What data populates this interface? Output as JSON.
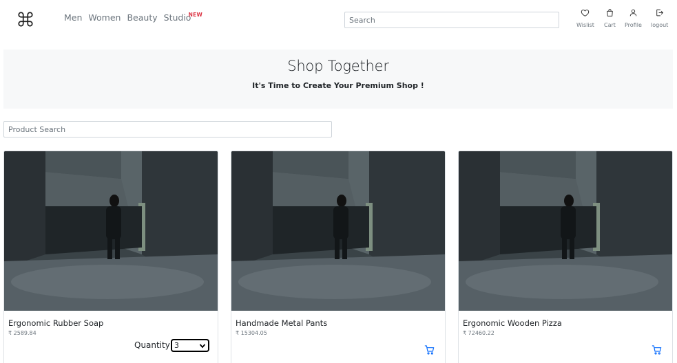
{
  "navbar": {
    "logo_icon": "command-key-icon",
    "links": [
      "Men",
      "Women",
      "Beauty",
      "Studio"
    ],
    "studio_badge": "NEW",
    "search_placeholder": "Search",
    "icons": [
      {
        "label": "Wislist",
        "icon": "heart-icon"
      },
      {
        "label": "Cart",
        "icon": "shopping-bag-icon"
      },
      {
        "label": "Profile",
        "icon": "user-icon"
      },
      {
        "label": "logout",
        "icon": "logout-icon"
      }
    ]
  },
  "hero": {
    "title": "Shop Together",
    "subtitle": "It's Time to Create Your Premium Shop !"
  },
  "product_search": {
    "placeholder": "Product Search"
  },
  "products": [
    {
      "name": "Ergonomic Rubber Soap",
      "price": "₹ 2589.84",
      "quantity_label": "Quantity",
      "quantity": "3"
    },
    {
      "name": "Handmade Metal Pants",
      "price": "₹ 15304.05"
    },
    {
      "name": "Ergonomic Wooden Pizza",
      "price": "₹ 72460.22"
    }
  ],
  "colors": {
    "badge": "#dc3545",
    "cart_icon": "#0d6efd",
    "hero_bg": "#f7f8f9"
  }
}
